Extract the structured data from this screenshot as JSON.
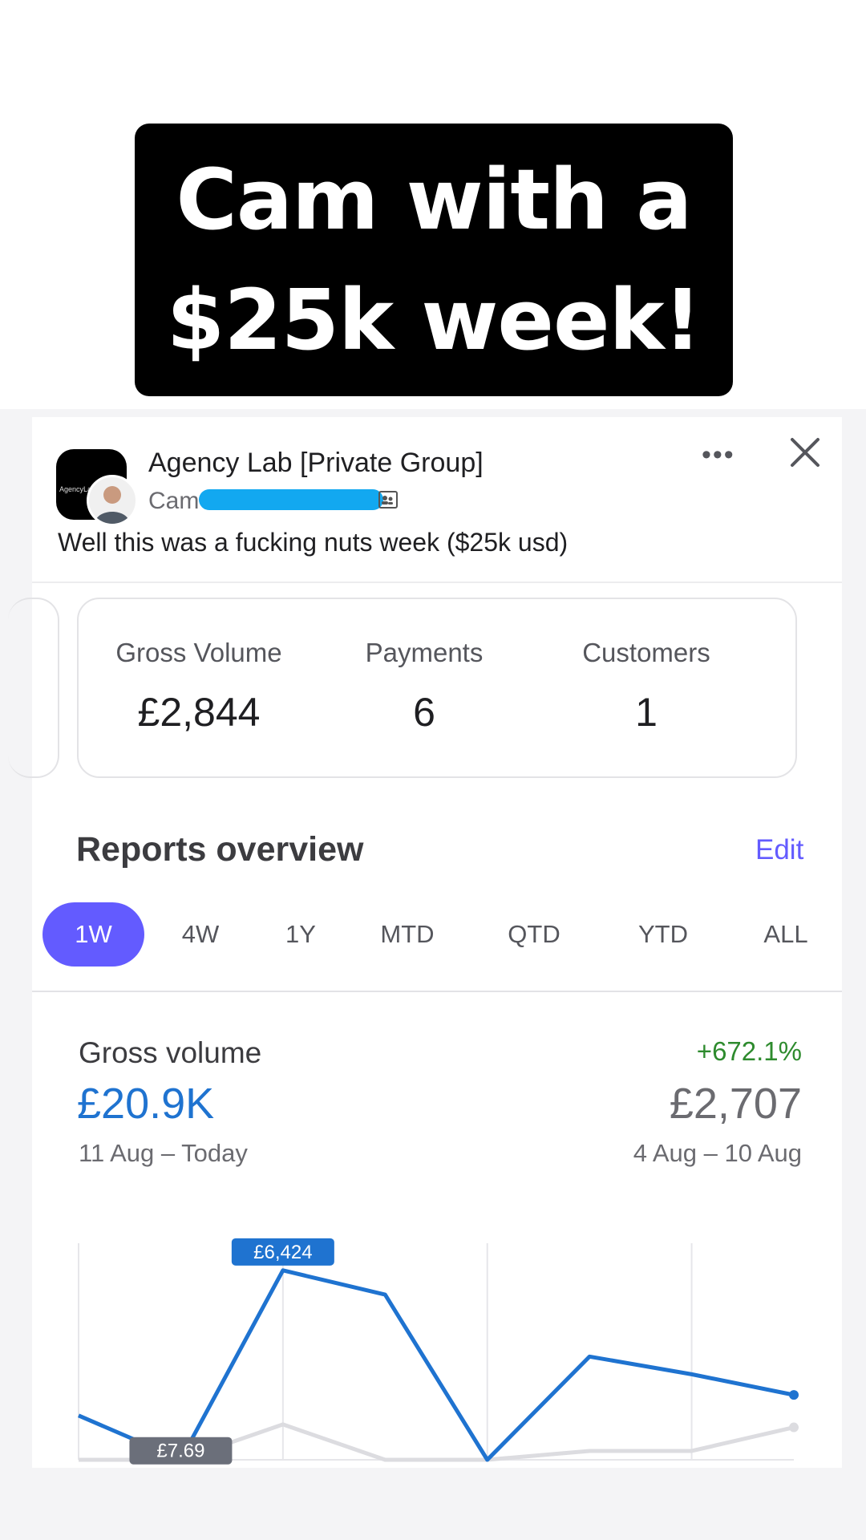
{
  "headline": {
    "line1": "Cam with a",
    "line2": "$25k week!"
  },
  "post": {
    "group_name": "Agency Lab [Private Group]",
    "group_logo_text": "AgencyLa",
    "author_name": "Cam",
    "text": "Well this was a fucking nuts week ($25k usd)",
    "more_label": "•••"
  },
  "stats": [
    {
      "label": "Gross Volume",
      "value": "£2,844"
    },
    {
      "label": "Payments",
      "value": "6"
    },
    {
      "label": "Customers",
      "value": "1"
    }
  ],
  "reports": {
    "title": "Reports overview",
    "edit_label": "Edit",
    "tabs": [
      "1W",
      "4W",
      "1Y",
      "MTD",
      "QTD",
      "YTD",
      "ALL"
    ],
    "active_tab": "1W"
  },
  "gross_volume": {
    "title": "Gross volume",
    "value": "£20.9K",
    "range": "11 Aug – Today",
    "change": "+672.1%",
    "prev_value": "£2,707",
    "prev_range": "4 Aug – 10 Aug"
  },
  "colors": {
    "accent": "#635bff",
    "current_series": "#1f73d0",
    "previous_series": "#dcdce0",
    "positive": "#2e8b2e"
  },
  "chart_data": {
    "type": "line",
    "series": [
      {
        "values": [
          1500,
          7.69,
          6424,
          5600,
          0,
          3500,
          2900,
          2200
        ]
      },
      {
        "values": [
          0,
          0,
          1200,
          0,
          0,
          300,
          300,
          1100
        ]
      }
    ],
    "annotations": [
      {
        "text": "£6,424",
        "series": 0,
        "index": 2
      },
      {
        "text": "£7.69",
        "series": 0,
        "index": 1
      }
    ],
    "ylim": [
      0,
      6800
    ],
    "grid": true
  }
}
